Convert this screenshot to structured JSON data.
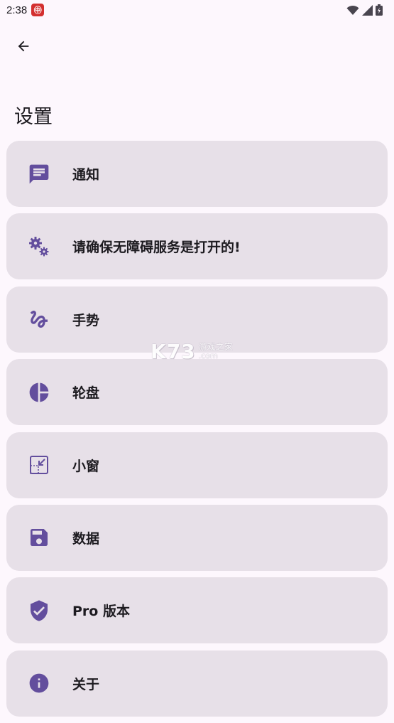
{
  "status_bar": {
    "time": "2:38",
    "notification_icon": "app-notification-icon",
    "notification_glyph": "㊥",
    "icons": [
      "wifi-icon",
      "signal-icon",
      "battery-icon"
    ]
  },
  "header": {
    "back_icon": "arrow-back-icon",
    "title": "设置"
  },
  "accent_color": "#634e9d",
  "card_color": "#e7e0e8",
  "settings_items": [
    {
      "label": "通知",
      "icon": "message-icon"
    },
    {
      "label": "请确保无障碍服务是打开的!",
      "icon": "gears-icon"
    },
    {
      "label": "手势",
      "icon": "gesture-icon"
    },
    {
      "label": "轮盘",
      "icon": "pie-chart-icon"
    },
    {
      "label": "小窗",
      "icon": "picture-in-picture-icon"
    },
    {
      "label": "数据",
      "icon": "save-icon"
    },
    {
      "label": "Pro 版本",
      "icon": "verified-shield-icon"
    },
    {
      "label": "关于",
      "icon": "info-icon"
    }
  ],
  "watermark": {
    "logo": "K73",
    "line1": "游戏之家",
    "line2": ".com"
  }
}
